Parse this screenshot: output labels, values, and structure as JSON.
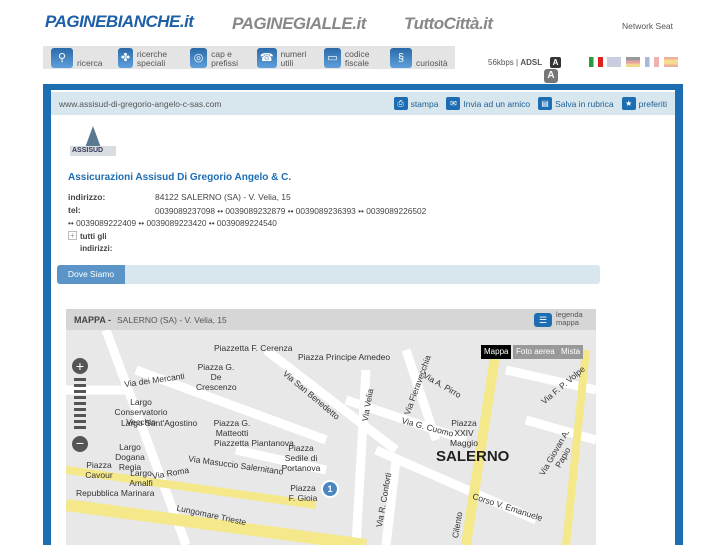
{
  "header": {
    "logos": [
      "PAGINEBIANCHE.it",
      "PAGINEGIALLE.it",
      "TuttoCittà.it"
    ],
    "network": "Network Seat"
  },
  "nav": [
    {
      "icon": "search-icon",
      "label": "ricerca"
    },
    {
      "icon": "clover-icon",
      "label": "ricerche speciali"
    },
    {
      "icon": "globe-search-icon",
      "label": "cap e prefissi"
    },
    {
      "icon": "phone-icon",
      "label": "numeri utili"
    },
    {
      "icon": "card-icon",
      "label": "codice fiscale"
    },
    {
      "icon": "spring-icon",
      "label": "curiosità"
    }
  ],
  "connection": {
    "slow": "56kbps",
    "fast": "ADSL",
    "font_small": "A",
    "font_large": "A"
  },
  "toolbar": {
    "url": "www.assisud-di-gregorio-angelo-c-sas.com",
    "print": "stampa",
    "send": "Invia ad un amico",
    "save": "Salva in rubrica",
    "favorites": "preferiti"
  },
  "business": {
    "logo_text": "ASSISUD",
    "name": "Assicurazioni Assisud Di Gregorio Angelo & C.",
    "address_label": "indirizzo:",
    "address": "84122 SALERNO (SA) - V. Velia, 15",
    "tel_label": "tel:",
    "tel_line1": "0039089237098 •• 0039089232879 •• 0039089236393 •• 0039089226502",
    "tel_line2": "•• 0039089222409 •• 0039089223420 •• 0039089224540",
    "all_addresses": "tutti gli indirizzi:"
  },
  "tabs": {
    "active": "Dove Siamo"
  },
  "map": {
    "title": "MAPPA -",
    "address": "SALERNO (SA) - V. Velia, 15",
    "legend": "legenda mappa",
    "modes": [
      "Mappa",
      "Foto aerea",
      "Mista"
    ],
    "marker": "1",
    "city": "SALERNO",
    "labels": [
      "Piazzetta F. Cerenza",
      "Piazza Principe Amedeo",
      "Via San Benedetto",
      "Via dei Mercanti",
      "Piazza G. De Crescenzo",
      "Largo Conservatorio Vecchio",
      "Largo Sant'Agostino",
      "Piazza G. Matteotti",
      "Piazzetta Piantanova",
      "Largo Dogana Regia",
      "Via Masuccio Salernitano",
      "Piazza Cavour",
      "Largo Amalfi",
      "Repubblica Marinara",
      "Via Roma",
      "Lungomare Trieste",
      "Piazza Sedile di Portanova",
      "Piazza F. Gioia",
      "Via Velia",
      "Via Fieravecchia",
      "Via A. Pirro",
      "Via G. Cuomo",
      "Piazza XXIV Maggio",
      "Via F. P. Volpe",
      "Via Giovan A. Papio",
      "Corso V. Emanuele",
      "Via R. Conforti",
      "Cilento"
    ]
  }
}
